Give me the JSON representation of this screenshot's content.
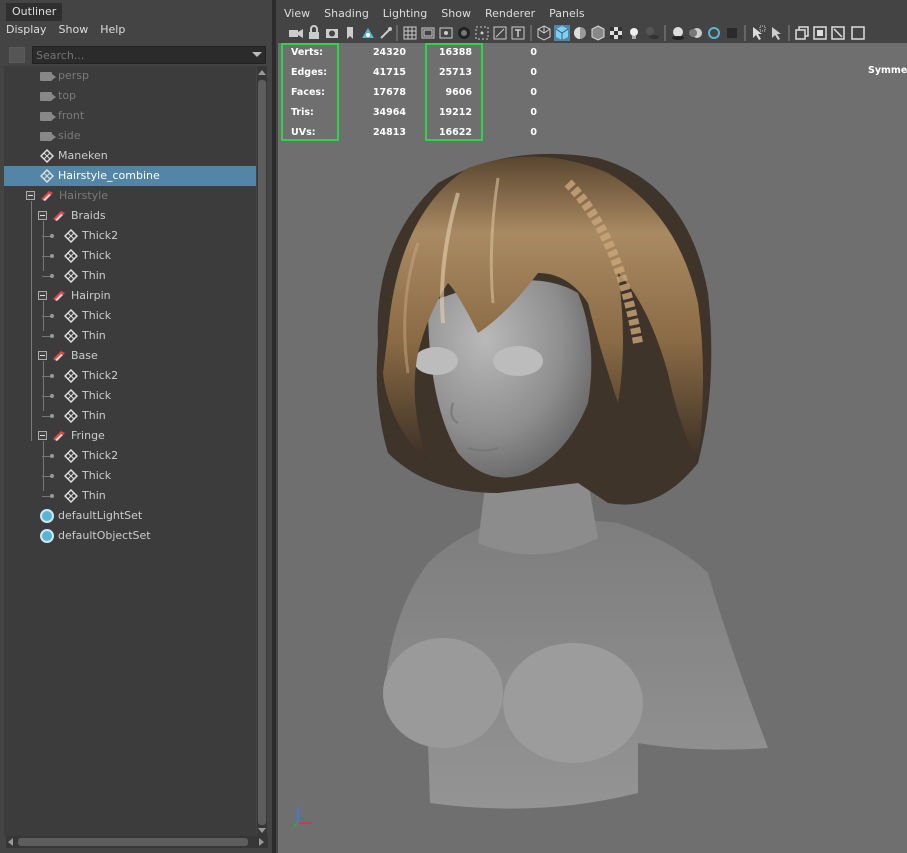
{
  "outliner": {
    "title": "Outliner",
    "menu": [
      "Display",
      "Show",
      "Help"
    ],
    "search_placeholder": "Search...",
    "items": [
      {
        "label": "persp",
        "icon": "camera-icon",
        "depth": 0,
        "dim": true
      },
      {
        "label": "top",
        "icon": "camera-icon",
        "depth": 0,
        "dim": true
      },
      {
        "label": "front",
        "icon": "camera-icon",
        "depth": 0,
        "dim": true
      },
      {
        "label": "side",
        "icon": "camera-icon",
        "depth": 0,
        "dim": true
      },
      {
        "label": "Maneken",
        "icon": "mesh-icon",
        "depth": 0
      },
      {
        "label": "Hairstyle_combine",
        "icon": "mesh-icon",
        "depth": 0,
        "selected": true
      },
      {
        "label": "Hairstyle",
        "icon": "group-icon",
        "depth": 0,
        "dim": true,
        "expander": true
      },
      {
        "label": "Braids",
        "icon": "group-icon",
        "depth": 1,
        "expander": true
      },
      {
        "label": "Thick2",
        "icon": "mesh-icon",
        "depth": 2
      },
      {
        "label": "Thick",
        "icon": "mesh-icon",
        "depth": 2
      },
      {
        "label": "Thin",
        "icon": "mesh-icon",
        "depth": 2
      },
      {
        "label": "Hairpin",
        "icon": "group-icon",
        "depth": 1,
        "expander": true
      },
      {
        "label": "Thick",
        "icon": "mesh-icon",
        "depth": 2
      },
      {
        "label": "Thin",
        "icon": "mesh-icon",
        "depth": 2
      },
      {
        "label": "Base",
        "icon": "group-icon",
        "depth": 1,
        "expander": true
      },
      {
        "label": "Thick2",
        "icon": "mesh-icon",
        "depth": 2
      },
      {
        "label": "Thick",
        "icon": "mesh-icon",
        "depth": 2
      },
      {
        "label": "Thin",
        "icon": "mesh-icon",
        "depth": 2
      },
      {
        "label": "Fringe",
        "icon": "group-icon",
        "depth": 1,
        "expander": true
      },
      {
        "label": "Thick2",
        "icon": "mesh-icon",
        "depth": 2
      },
      {
        "label": "Thick",
        "icon": "mesh-icon",
        "depth": 2
      },
      {
        "label": "Thin",
        "icon": "mesh-icon",
        "depth": 2
      },
      {
        "label": "defaultLightSet",
        "icon": "set-icon",
        "depth": 0
      },
      {
        "label": "defaultObjectSet",
        "icon": "set-icon",
        "depth": 0
      }
    ]
  },
  "viewport": {
    "menu": [
      "View",
      "Shading",
      "Lighting",
      "Show",
      "Renderer",
      "Panels"
    ],
    "hud": [
      {
        "label": "Verts:",
        "scene": "24320",
        "selected": "16388",
        "comp": "0"
      },
      {
        "label": "Edges:",
        "scene": "41715",
        "selected": "25713",
        "comp": "0"
      },
      {
        "label": "Faces:",
        "scene": "17678",
        "selected": "9606",
        "comp": "0"
      },
      {
        "label": "Tris:",
        "scene": "34964",
        "selected": "19212",
        "comp": "0"
      },
      {
        "label": "UVs:",
        "scene": "24813",
        "selected": "16622",
        "comp": "0"
      }
    ],
    "symmetry_text": "Symmet",
    "highlight_color": "#2ed34a"
  }
}
